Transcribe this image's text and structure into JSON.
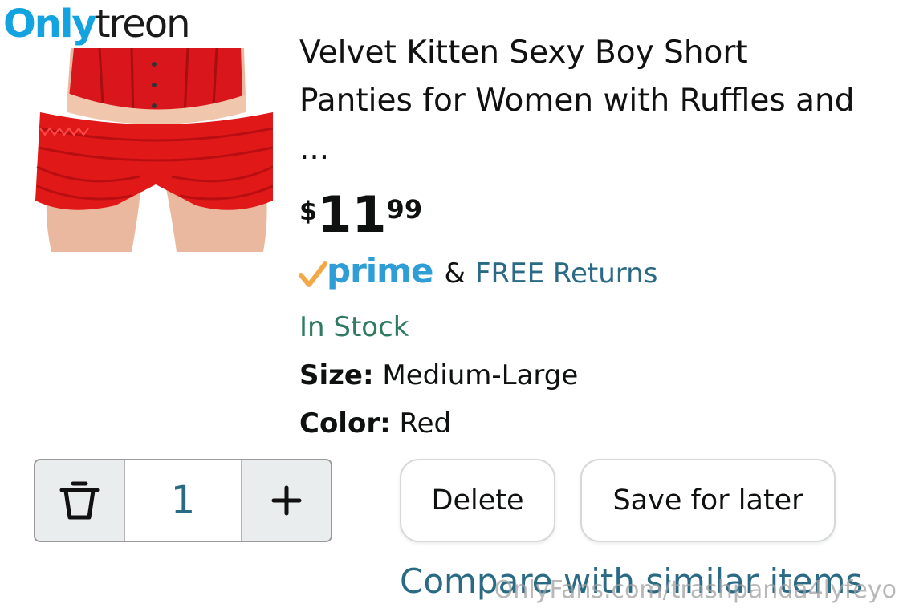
{
  "watermark": {
    "logo_part1": "Only",
    "logo_part2": "treon",
    "url": "OnlyFans.com/trashpanda4lyfeyo"
  },
  "product": {
    "title": "Velvet Kitten Sexy Boy Short Panties for Women with Ruffles and ...",
    "image_icon": "product-photo-red-ruffle-shorts",
    "price": {
      "symbol": "$",
      "whole": "11",
      "fraction": "99"
    },
    "prime_label": "prime",
    "ampersand": "&",
    "free_returns": "FREE Returns",
    "stock_status": "In Stock",
    "size_label": "Size:",
    "size_value": "Medium-Large",
    "color_label": "Color:",
    "color_value": "Red"
  },
  "cart_actions": {
    "quantity": "1",
    "trash_icon": "trash-icon",
    "plus_icon": "plus-icon",
    "delete_label": "Delete",
    "save_label": "Save for later",
    "compare_label": "Compare with similar items"
  },
  "colors": {
    "link": "#2a6a85",
    "stock": "#2e7b5f",
    "prime_blue": "#2f9ed6",
    "prime_check": "#f3a847",
    "product_red": "#e01818"
  }
}
